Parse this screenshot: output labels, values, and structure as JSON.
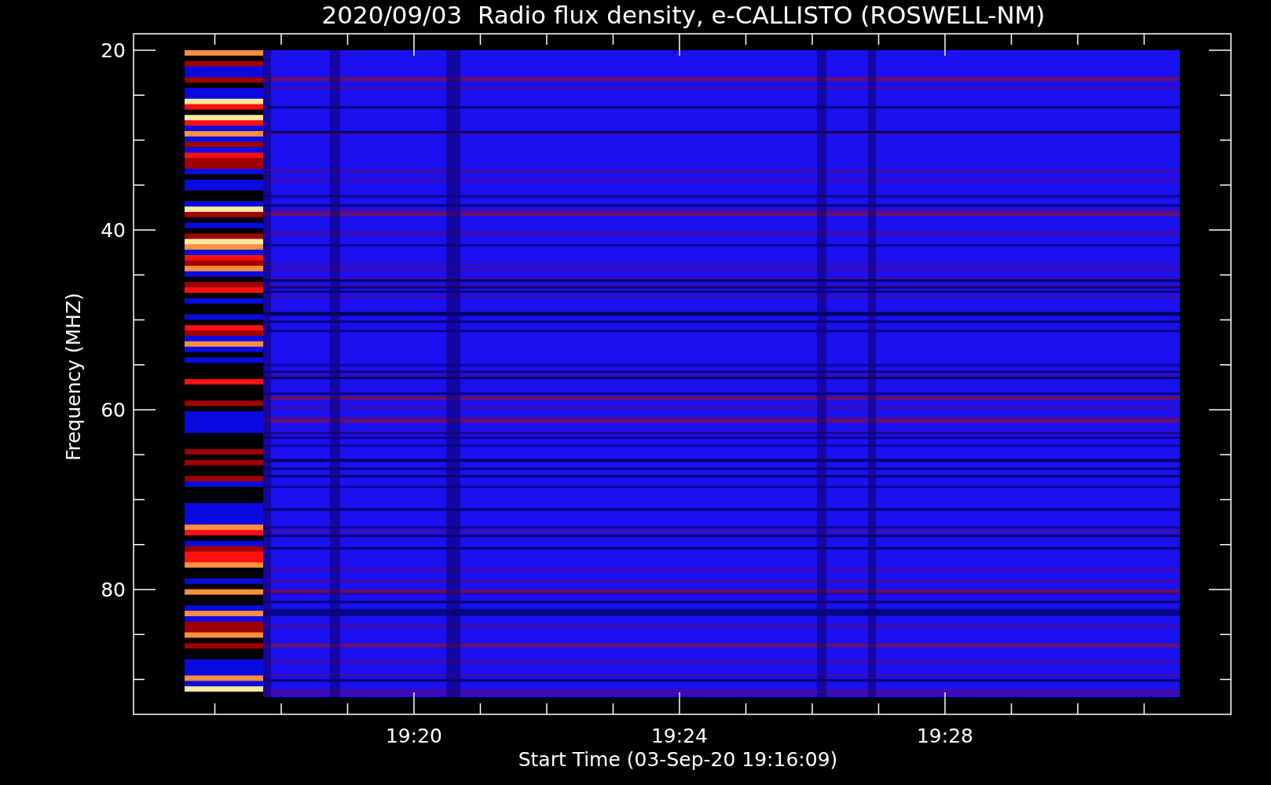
{
  "title": "2020/09/03  Radio flux density, e-CALLISTO (ROSWELL-NM)",
  "y_axis": {
    "label": "Frequency (MHZ)",
    "tick_labels": [
      "20",
      "40",
      "60",
      "80"
    ]
  },
  "x_axis": {
    "label": "Start Time (03-Sep-20 19:16:09)",
    "tick_labels": [
      "19:20",
      "19:24",
      "19:28"
    ]
  }
}
